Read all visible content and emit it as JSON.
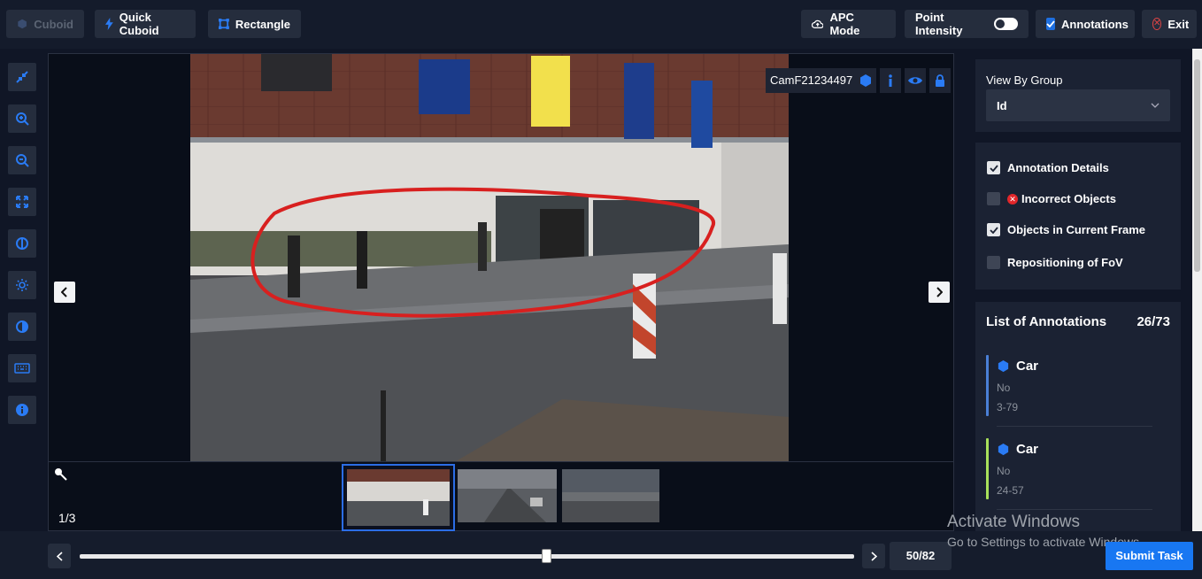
{
  "toolbar": {
    "cuboid_label": "Cuboid",
    "quick_cuboid_label": "Quick Cuboid",
    "rectangle_label": "Rectangle",
    "apc_mode_label": "APC Mode",
    "point_intensity_label": "Point Intensity",
    "annotations_label": "Annotations",
    "exit_label": "Exit"
  },
  "viewer": {
    "camera_name": "CamF21234497",
    "page_indicator": "1/3"
  },
  "timeline": {
    "frame_counter": "50/82",
    "progress": 0.6
  },
  "submit_label": "Submit Task",
  "right_panel": {
    "view_by_group_label": "View By Group",
    "group_select_value": "Id",
    "filters": [
      {
        "label": "Annotation Details",
        "checked": true
      },
      {
        "label": "Incorrect Objects",
        "checked": false
      },
      {
        "label": "Objects in Current Frame",
        "checked": true
      },
      {
        "label": "Repositioning of FoV",
        "checked": false
      }
    ],
    "annotations_title": "List of Annotations",
    "annotations_count": "26/73",
    "annotations": [
      {
        "label": "Car",
        "line1": "No",
        "line2": "3-79",
        "color": "#4a7fd6"
      },
      {
        "label": "Car",
        "line1": "No",
        "line2": "24-57",
        "color": "#a8e05a"
      }
    ]
  },
  "watermark": {
    "line1": "Activate Windows",
    "line2": "Go to Settings to activate Windows."
  },
  "colors": {
    "accent": "#1877f2",
    "annotation_stroke": "#d8201f"
  }
}
